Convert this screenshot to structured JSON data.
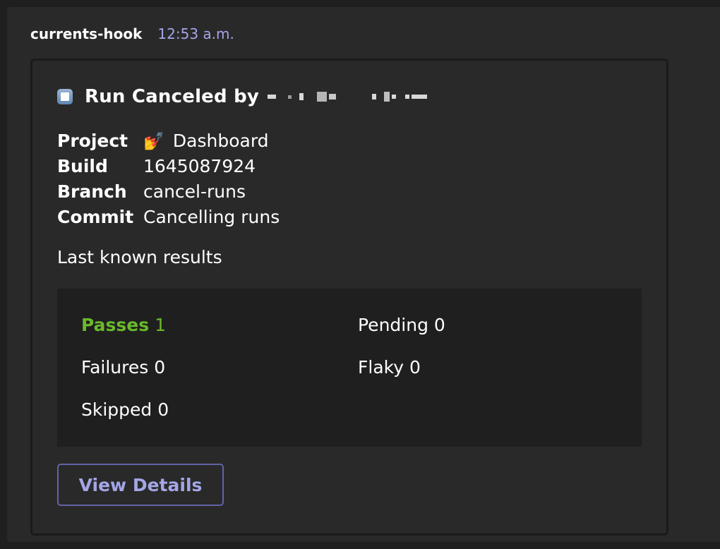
{
  "message": {
    "sender": "currents-hook",
    "timestamp": "12:53 a.m."
  },
  "card": {
    "title": "Run Canceled by",
    "title_icon": "stop-button-icon",
    "facts": [
      {
        "key": "Project",
        "value": "Dashboard",
        "icon": "nail-polish-icon"
      },
      {
        "key": "Build",
        "value": "1645087924"
      },
      {
        "key": "Branch",
        "value": "cancel-runs"
      },
      {
        "key": "Commit",
        "value": "Cancelling runs"
      }
    ],
    "results_heading": "Last known results",
    "results": {
      "passes_label": "Passes",
      "passes_value": "1",
      "pending": "Pending 0",
      "failures": "Failures 0",
      "flaky": "Flaky 0",
      "skipped": "Skipped 0"
    },
    "button_label": "View Details"
  },
  "colors": {
    "accent": "#6264a7",
    "accent_text": "#a4a6e6",
    "passes": "#6ab92b",
    "background": "#292929",
    "results_background": "#1f1f1f"
  }
}
